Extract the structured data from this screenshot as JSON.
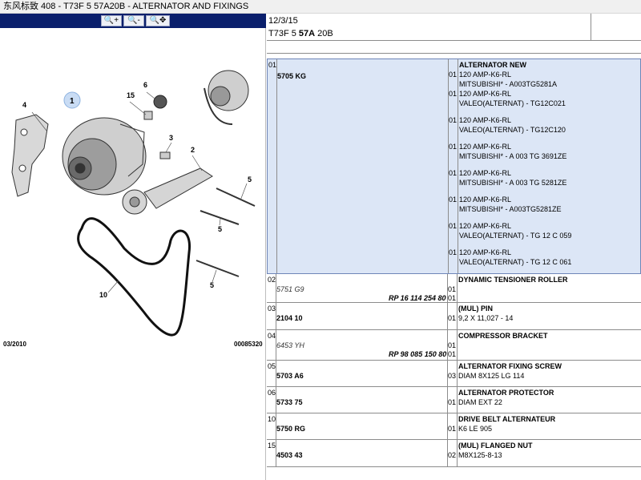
{
  "window_title": "东风标致 408 - T73F 5 57A20B - ALTERNATOR AND FIXINGS",
  "toolbar": {
    "buttons": [
      {
        "name": "zoom-in",
        "glyph": "🔍+"
      },
      {
        "name": "zoom-out",
        "glyph": "🔍-"
      },
      {
        "name": "zoom-fit",
        "glyph": "🔍✥"
      }
    ]
  },
  "diagram": {
    "callouts": [
      "1",
      "15",
      "6",
      "4",
      "3",
      "2",
      "5",
      "5",
      "5",
      "10"
    ],
    "footer_left": "03/2010",
    "footer_right": "00085320"
  },
  "header": {
    "date": "12/3/15",
    "code_prefix": "T73F 5 ",
    "code_bold": "57A",
    "code_suffix": " 20B"
  },
  "parts": [
    {
      "idx": "01",
      "ref": "5705 KG",
      "title": "ALTERNATOR NEW",
      "variants": [
        {
          "qty": "01",
          "line1": "120 AMP-K6-RL",
          "line2": "MITSUBISHI* - A003TG5281A"
        },
        {
          "qty": "01",
          "line1": "120 AMP-K6-RL",
          "line2": "VALEO(ALTERNAT) - TG12C021"
        },
        {
          "qty": "01",
          "line1": "120 AMP-K6-RL",
          "line2": "VALEO(ALTERNAT) - TG12C120"
        },
        {
          "qty": "01",
          "line1": "120 AMP-K6-RL",
          "line2": "MITSUBISHI* - A 003 TG 3691ZE"
        },
        {
          "qty": "01",
          "line1": "120 AMP-K6-RL",
          "line2": "MITSUBISHI* - A 003 TG 5281ZE"
        },
        {
          "qty": "01",
          "line1": "120 AMP-K6-RL",
          "line2": "MITSUBISHI* - A003TG5281ZE"
        },
        {
          "qty": "01",
          "line1": "120 AMP-K6-RL",
          "line2": "VALEO(ALTERNAT) - TG 12 C 059"
        },
        {
          "qty": "01",
          "line1": "120 AMP-K6-RL",
          "line2": "VALEO(ALTERNAT) - TG 12 C 061"
        }
      ]
    },
    {
      "idx": "02",
      "ref": "5751 G9",
      "ref_italic": true,
      "rp": "RP 16 114 254 80",
      "qty": "01",
      "qty2": "01",
      "title": "DYNAMIC TENSIONER ROLLER",
      "line": ""
    },
    {
      "idx": "03",
      "ref": "2104 10",
      "qty": "01",
      "title": "(MUL) PIN",
      "line": "9,2 X 11,027 - 14"
    },
    {
      "idx": "04",
      "ref": "6453 YH",
      "ref_italic": true,
      "rp": "RP 98 085 150 80",
      "qty": "01",
      "qty2": "01",
      "title": "COMPRESSOR BRACKET",
      "line": ""
    },
    {
      "idx": "05",
      "ref": "5703 A6",
      "qty": "03",
      "title": "ALTERNATOR FIXING SCREW",
      "line": "DIAM 8X125 LG 114"
    },
    {
      "idx": "06",
      "ref": "5733 75",
      "qty": "01",
      "title": "ALTERNATOR PROTECTOR",
      "line": "DIAM EXT 22"
    },
    {
      "idx": "10",
      "ref": "5750 RG",
      "qty": "01",
      "title": "DRIVE BELT ALTERNATEUR",
      "line": "K6 LE 905"
    },
    {
      "idx": "15",
      "ref": "4503 43",
      "qty": "02",
      "title": "(MUL) FLANGED NUT",
      "line": "M8X125-8-13"
    }
  ]
}
